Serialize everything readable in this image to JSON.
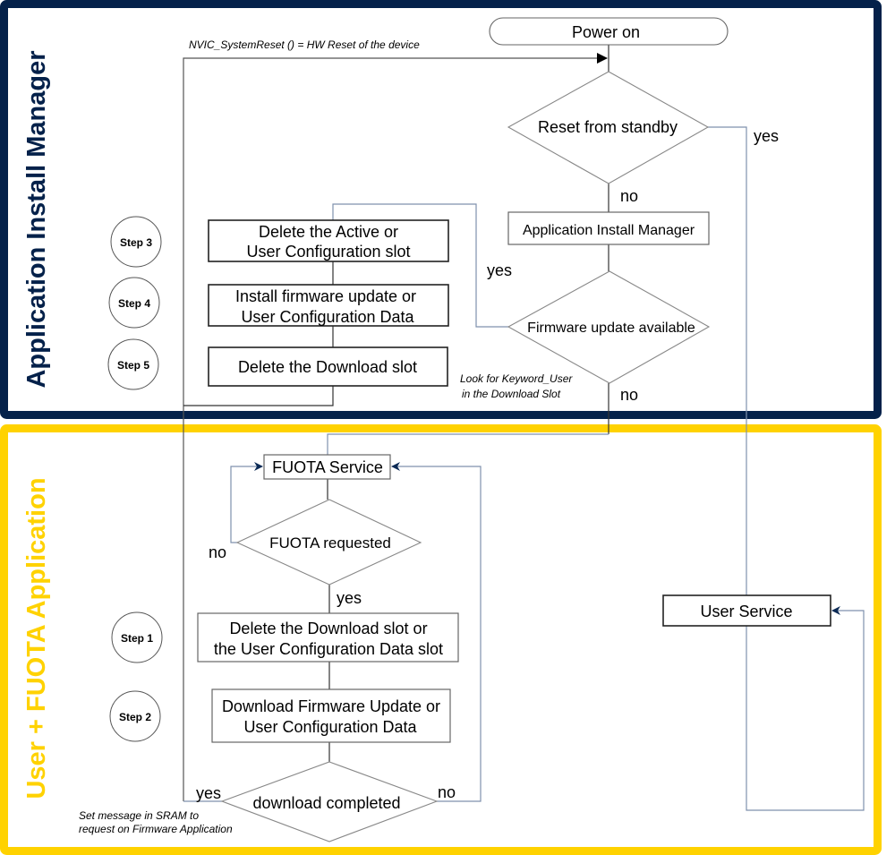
{
  "colors": {
    "install_manager_frame": "#04214a",
    "fuota_frame": "#ffd200",
    "connector": "#7f91ad",
    "arrow_head": "#0b2a55"
  },
  "lanes": {
    "install_manager": "Application Install Manager",
    "fuota": "User + FUOTA Application"
  },
  "nodes": {
    "power_on": "Power on",
    "reset_from_standby": "Reset from standby",
    "app_install_manager": "Application Install Manager",
    "firmware_update_available": "Firmware update available",
    "delete_active": [
      "Delete the Active or",
      "User Configuration slot"
    ],
    "install_firmware": [
      "Install firmware update or",
      "User Configuration Data"
    ],
    "delete_download": "Delete the Download slot",
    "fuota_service": "FUOTA Service",
    "fuota_requested": "FUOTA requested",
    "delete_download_or_config": [
      "Delete the Download slot or",
      "the User Configuration Data slot"
    ],
    "download_firmware": [
      "Download Firmware Update or",
      "User Configuration Data"
    ],
    "download_completed": "download completed",
    "user_service": "User Service"
  },
  "steps": [
    "Step 1",
    "Step 2",
    "Step 3",
    "Step 4",
    "Step 5"
  ],
  "edge_labels": {
    "yes": "yes",
    "no": "no"
  },
  "notes": {
    "nvic": "NVIC_SystemReset () = HW Reset of the device",
    "keyword": [
      "Look for  Keyword_User",
      "in the Download Slot"
    ],
    "sram": [
      "Set message in SRAM to",
      "request on Firmware Application"
    ]
  }
}
